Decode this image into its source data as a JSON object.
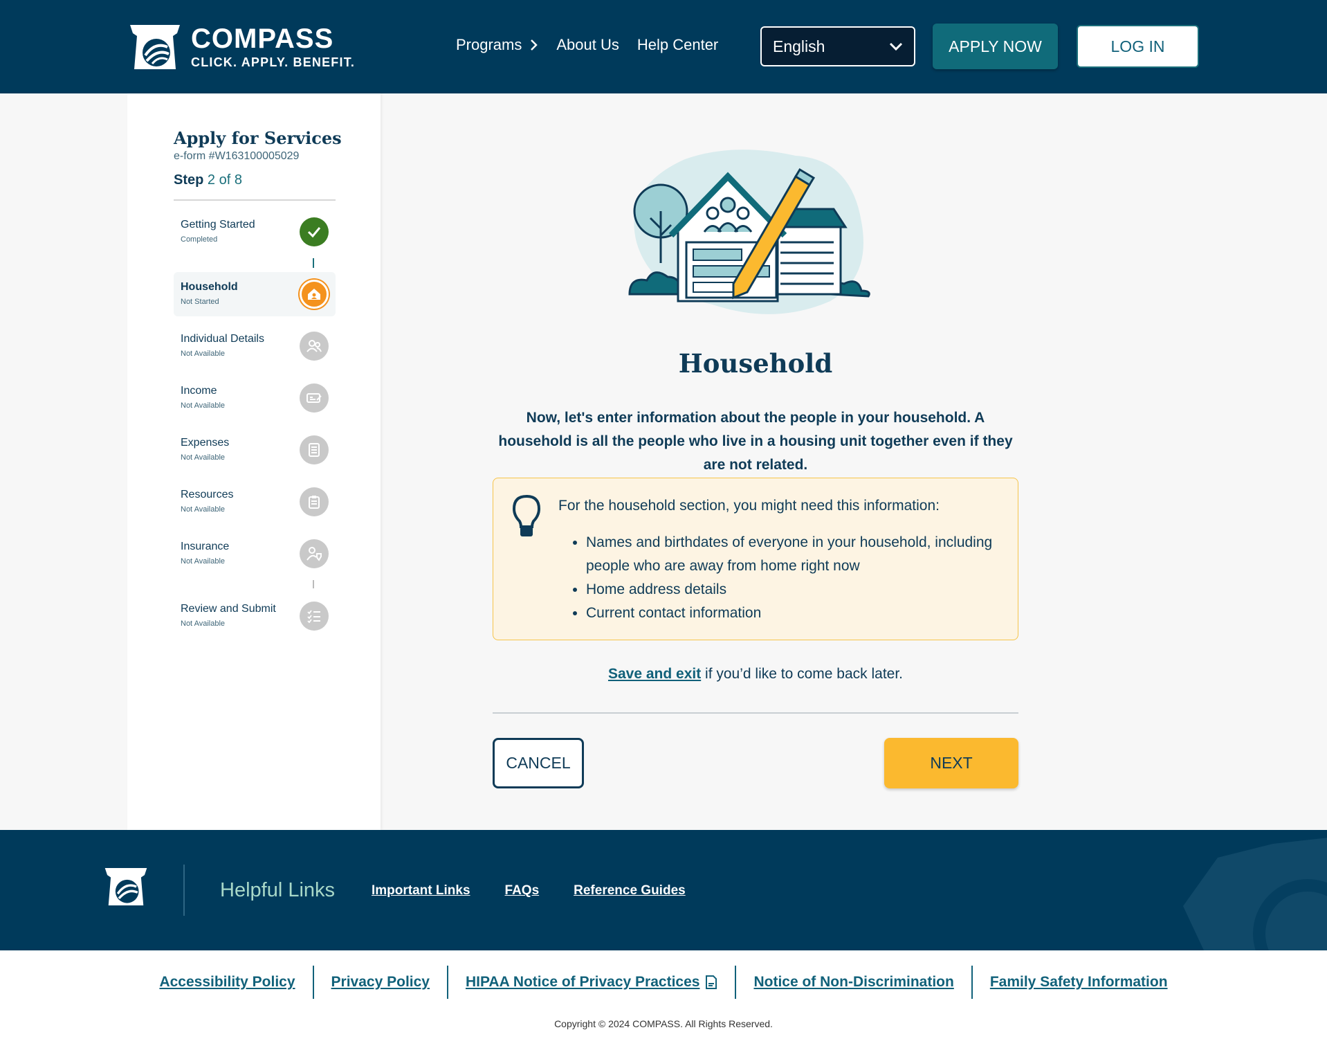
{
  "header": {
    "brand_title": "COMPASS",
    "brand_tagline": "CLICK. APPLY. BENEFIT.",
    "nav": [
      "Programs",
      "About Us",
      "Help Center"
    ],
    "language": "English",
    "apply_label": "APPLY NOW",
    "login_label": "LOG IN"
  },
  "sidebar": {
    "title": "Apply for Services",
    "form_id": "e-form #W163100005029",
    "step_word": "Step",
    "step_progress": "2 of 8",
    "steps": [
      {
        "label": "Getting Started",
        "status": "Completed",
        "icon": "check-icon"
      },
      {
        "label": "Household",
        "status": "Not Started",
        "icon": "home-icon"
      },
      {
        "label": "Individual Details",
        "status": "Not Available",
        "icon": "people-icon"
      },
      {
        "label": "Income",
        "status": "Not Available",
        "icon": "money-icon"
      },
      {
        "label": "Expenses",
        "status": "Not Available",
        "icon": "document-icon"
      },
      {
        "label": "Resources",
        "status": "Not Available",
        "icon": "clipboard-icon"
      },
      {
        "label": "Insurance",
        "status": "Not Available",
        "icon": "person-shield-icon"
      },
      {
        "label": "Review and Submit",
        "status": "Not Available",
        "icon": "checklist-icon"
      }
    ]
  },
  "main": {
    "title": "Household",
    "description": "Now, let's enter information about the people in your household. A household is all the people who live in a housing unit together even if they are not related.",
    "info_lead": "For the household section, you might need this information:",
    "info_items": [
      "Names and birthdates of everyone in your household, including people who are away from home right now",
      "Home address details",
      "Current contact information"
    ],
    "save_link": "Save and exit",
    "save_suffix": " if you’d like to come back later.",
    "cancel_label": "CANCEL",
    "next_label": "NEXT"
  },
  "footer": {
    "helpful_title": "Helpful Links",
    "links": [
      "Important Links",
      "FAQs",
      "Reference Guides"
    ],
    "legal_links": [
      "Accessibility Policy",
      "Privacy Policy",
      "HIPAA Notice of Privacy Practices",
      "Notice of Non-Discrimination",
      "Family Safety Information"
    ],
    "copyright": "Copyright © 2024 COMPASS. All Rights Reserved."
  },
  "colors": {
    "header_bg": "#003a5b",
    "accent_teal": "#106b7a",
    "next_yellow": "#fbb92f",
    "completed_green": "#3b7d22",
    "current_orange": "#f4921d",
    "info_bg": "#fdf4e3"
  }
}
